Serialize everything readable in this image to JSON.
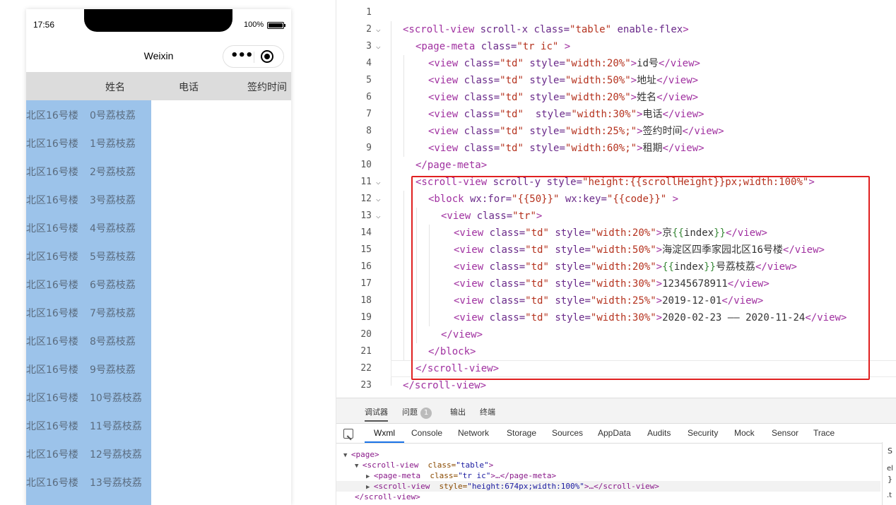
{
  "simulator": {
    "status_time": "17:56",
    "battery": "100%",
    "nav_title": "Weixin",
    "capsule_more": "•••",
    "headers": [
      "姓名",
      "电话",
      "签约时间"
    ],
    "rows": [
      {
        "addr": "北区16号楼",
        "name": "0号荔枝荔"
      },
      {
        "addr": "北区16号楼",
        "name": "1号荔枝荔"
      },
      {
        "addr": "北区16号楼",
        "name": "2号荔枝荔"
      },
      {
        "addr": "北区16号楼",
        "name": "3号荔枝荔"
      },
      {
        "addr": "北区16号楼",
        "name": "4号荔枝荔"
      },
      {
        "addr": "北区16号楼",
        "name": "5号荔枝荔"
      },
      {
        "addr": "北区16号楼",
        "name": "6号荔枝荔"
      },
      {
        "addr": "北区16号楼",
        "name": "7号荔枝荔"
      },
      {
        "addr": "北区16号楼",
        "name": "8号荔枝荔"
      },
      {
        "addr": "北区16号楼",
        "name": "9号荔枝荔"
      },
      {
        "addr": "北区16号楼",
        "name": "10号荔枝荔"
      },
      {
        "addr": "北区16号楼",
        "name": "11号荔枝荔"
      },
      {
        "addr": "北区16号楼",
        "name": "12号荔枝荔"
      },
      {
        "addr": "北区16号楼",
        "name": "13号荔枝荔"
      }
    ]
  },
  "editor": {
    "lines": [
      {
        "n": "1",
        "indent": 0,
        "fold": false,
        "parts": []
      },
      {
        "n": "2",
        "indent": 0,
        "fold": true,
        "parts": [
          [
            "t",
            "<scroll-view"
          ],
          [
            "a",
            " scroll-x class="
          ],
          [
            "s",
            "\"table\""
          ],
          [
            "a",
            " enable-flex"
          ],
          [
            "t",
            ">"
          ]
        ]
      },
      {
        "n": "3",
        "indent": 1,
        "fold": true,
        "parts": [
          [
            "t",
            "<page-meta"
          ],
          [
            "a",
            " class="
          ],
          [
            "s",
            "\"tr ic\""
          ],
          [
            "t",
            " >"
          ]
        ]
      },
      {
        "n": "4",
        "indent": 2,
        "fold": false,
        "parts": [
          [
            "t",
            "<view"
          ],
          [
            "a",
            " class="
          ],
          [
            "s",
            "\"td\""
          ],
          [
            "a",
            " style="
          ],
          [
            "s",
            "\"width:20%\""
          ],
          [
            "t",
            ">"
          ],
          [
            "c",
            "id号"
          ],
          [
            "t",
            "</view>"
          ]
        ]
      },
      {
        "n": "5",
        "indent": 2,
        "fold": false,
        "parts": [
          [
            "t",
            "<view"
          ],
          [
            "a",
            " class="
          ],
          [
            "s",
            "\"td\""
          ],
          [
            "a",
            " style="
          ],
          [
            "s",
            "\"width:50%\""
          ],
          [
            "t",
            ">"
          ],
          [
            "c",
            "地址"
          ],
          [
            "t",
            "</view>"
          ]
        ]
      },
      {
        "n": "6",
        "indent": 2,
        "fold": false,
        "parts": [
          [
            "t",
            "<view"
          ],
          [
            "a",
            " class="
          ],
          [
            "s",
            "\"td\""
          ],
          [
            "a",
            " style="
          ],
          [
            "s",
            "\"width:20%\""
          ],
          [
            "t",
            ">"
          ],
          [
            "c",
            "姓名"
          ],
          [
            "t",
            "</view>"
          ]
        ]
      },
      {
        "n": "7",
        "indent": 2,
        "fold": false,
        "parts": [
          [
            "t",
            "<view"
          ],
          [
            "a",
            " class="
          ],
          [
            "s",
            "\"td\""
          ],
          [
            "a",
            "  style="
          ],
          [
            "s",
            "\"width:30%\""
          ],
          [
            "t",
            ">"
          ],
          [
            "c",
            "电话"
          ],
          [
            "t",
            "</view>"
          ]
        ]
      },
      {
        "n": "8",
        "indent": 2,
        "fold": false,
        "parts": [
          [
            "t",
            "<view"
          ],
          [
            "a",
            " class="
          ],
          [
            "s",
            "\"td\""
          ],
          [
            "a",
            " style="
          ],
          [
            "s",
            "\"width:25%;\""
          ],
          [
            "t",
            ">"
          ],
          [
            "c",
            "签约时间"
          ],
          [
            "t",
            "</view>"
          ]
        ]
      },
      {
        "n": "9",
        "indent": 2,
        "fold": false,
        "parts": [
          [
            "t",
            "<view"
          ],
          [
            "a",
            " class="
          ],
          [
            "s",
            "\"td\""
          ],
          [
            "a",
            " style="
          ],
          [
            "s",
            "\"width:60%;\""
          ],
          [
            "t",
            ">"
          ],
          [
            "c",
            "租期"
          ],
          [
            "t",
            "</view>"
          ]
        ]
      },
      {
        "n": "10",
        "indent": 1,
        "fold": false,
        "parts": [
          [
            "t",
            "</page-meta>"
          ]
        ]
      },
      {
        "n": "11",
        "indent": 1,
        "fold": true,
        "parts": [
          [
            "t",
            "<scroll-view"
          ],
          [
            "a",
            " scroll-y style="
          ],
          [
            "s",
            "\"height:{{scrollHeight}}px;width:100%\""
          ],
          [
            "t",
            ">"
          ]
        ]
      },
      {
        "n": "12",
        "indent": 2,
        "fold": true,
        "parts": [
          [
            "t",
            "<block"
          ],
          [
            "a",
            " wx:for="
          ],
          [
            "s",
            "\"{{50}}\""
          ],
          [
            "a",
            " wx:key="
          ],
          [
            "s",
            "\"{{code}}\""
          ],
          [
            "t",
            " >"
          ]
        ]
      },
      {
        "n": "13",
        "indent": 3,
        "fold": true,
        "parts": [
          [
            "t",
            "<view"
          ],
          [
            "a",
            " class="
          ],
          [
            "s",
            "\"tr\""
          ],
          [
            "t",
            ">"
          ]
        ]
      },
      {
        "n": "14",
        "indent": 4,
        "fold": false,
        "parts": [
          [
            "t",
            "<view"
          ],
          [
            "a",
            " class="
          ],
          [
            "s",
            "\"td\""
          ],
          [
            "a",
            " style="
          ],
          [
            "s",
            "\"width:20%\""
          ],
          [
            "t",
            ">"
          ],
          [
            "c",
            "京"
          ],
          [
            "s2",
            "{{"
          ],
          [
            "c",
            "index"
          ],
          [
            "s2",
            "}}"
          ],
          [
            "t",
            "</view>"
          ]
        ]
      },
      {
        "n": "15",
        "indent": 4,
        "fold": false,
        "parts": [
          [
            "t",
            "<view"
          ],
          [
            "a",
            " class="
          ],
          [
            "s",
            "\"td\""
          ],
          [
            "a",
            " style="
          ],
          [
            "s",
            "\"width:50%\""
          ],
          [
            "t",
            ">"
          ],
          [
            "c",
            "海淀区四季家园北区16号楼"
          ],
          [
            "t",
            "</view>"
          ]
        ]
      },
      {
        "n": "16",
        "indent": 4,
        "fold": false,
        "parts": [
          [
            "t",
            "<view"
          ],
          [
            "a",
            " class="
          ],
          [
            "s",
            "\"td\""
          ],
          [
            "a",
            " style="
          ],
          [
            "s",
            "\"width:20%\""
          ],
          [
            "t",
            ">"
          ],
          [
            "s2",
            "{{"
          ],
          [
            "c",
            "index"
          ],
          [
            "s2",
            "}}"
          ],
          [
            "c",
            "号荔枝荔"
          ],
          [
            "t",
            "</view>"
          ]
        ]
      },
      {
        "n": "17",
        "indent": 4,
        "fold": false,
        "parts": [
          [
            "t",
            "<view"
          ],
          [
            "a",
            " class="
          ],
          [
            "s",
            "\"td\""
          ],
          [
            "a",
            " style="
          ],
          [
            "s",
            "\"width:30%\""
          ],
          [
            "t",
            ">"
          ],
          [
            "c",
            "12345678911"
          ],
          [
            "t",
            "</view>"
          ]
        ]
      },
      {
        "n": "18",
        "indent": 4,
        "fold": false,
        "parts": [
          [
            "t",
            "<view"
          ],
          [
            "a",
            " class="
          ],
          [
            "s",
            "\"td\""
          ],
          [
            "a",
            " style="
          ],
          [
            "s",
            "\"width:25%\""
          ],
          [
            "t",
            ">"
          ],
          [
            "c",
            "2019-12-01"
          ],
          [
            "t",
            "</view>"
          ]
        ]
      },
      {
        "n": "19",
        "indent": 4,
        "fold": false,
        "parts": [
          [
            "t",
            "<view"
          ],
          [
            "a",
            " class="
          ],
          [
            "s",
            "\"td\""
          ],
          [
            "a",
            " style="
          ],
          [
            "s",
            "\"width:30%\""
          ],
          [
            "t",
            ">"
          ],
          [
            "c",
            "2020-02-23 —— 2020-11-24"
          ],
          [
            "t",
            "</view>"
          ]
        ]
      },
      {
        "n": "20",
        "indent": 3,
        "fold": false,
        "parts": [
          [
            "t",
            "</view>"
          ]
        ]
      },
      {
        "n": "21",
        "indent": 2,
        "fold": false,
        "parts": [
          [
            "t",
            "</block>"
          ]
        ]
      },
      {
        "n": "22",
        "indent": 1,
        "fold": false,
        "parts": [
          [
            "t",
            "</scroll-view>"
          ]
        ]
      },
      {
        "n": "23",
        "indent": 0,
        "fold": false,
        "parts": [
          [
            "t",
            "</scroll-view>"
          ]
        ]
      }
    ]
  },
  "devtools": {
    "top_tabs": [
      "调试器",
      "问题",
      "输出",
      "终端"
    ],
    "issues_count": "1",
    "tabs": [
      "Wxml",
      "Console",
      "Network",
      "Storage",
      "Sources",
      "AppData",
      "Audits",
      "Security",
      "Mock",
      "Sensor",
      "Trace"
    ],
    "tree": [
      {
        "indent": 1,
        "arrow": "▼",
        "parts": [
          [
            "tt",
            "<page>"
          ]
        ]
      },
      {
        "indent": 2,
        "arrow": "▼",
        "parts": [
          [
            "tt",
            "<scroll-view "
          ],
          [
            "ta",
            " class="
          ],
          [
            "ts",
            "\"table\""
          ],
          [
            "tt",
            ">"
          ]
        ]
      },
      {
        "indent": 3,
        "arrow": "▶",
        "parts": [
          [
            "tt",
            "<page-meta "
          ],
          [
            "ta",
            " class="
          ],
          [
            "ts",
            "\"tr ic\""
          ],
          [
            "tt",
            ">…</page-meta>"
          ]
        ]
      },
      {
        "indent": 3,
        "arrow": "▶",
        "parts": [
          [
            "tt",
            "<scroll-view "
          ],
          [
            "ta",
            " style="
          ],
          [
            "ts",
            "\"height:674px;width:100%\""
          ],
          [
            "tt",
            ">…</scroll-view>"
          ]
        ]
      },
      {
        "indent": 2,
        "arrow": "",
        "parts": [
          [
            "tt",
            "</scroll-view>"
          ]
        ]
      }
    ],
    "side_glyphs": [
      "S",
      "el",
      "}",
      ".t"
    ]
  }
}
